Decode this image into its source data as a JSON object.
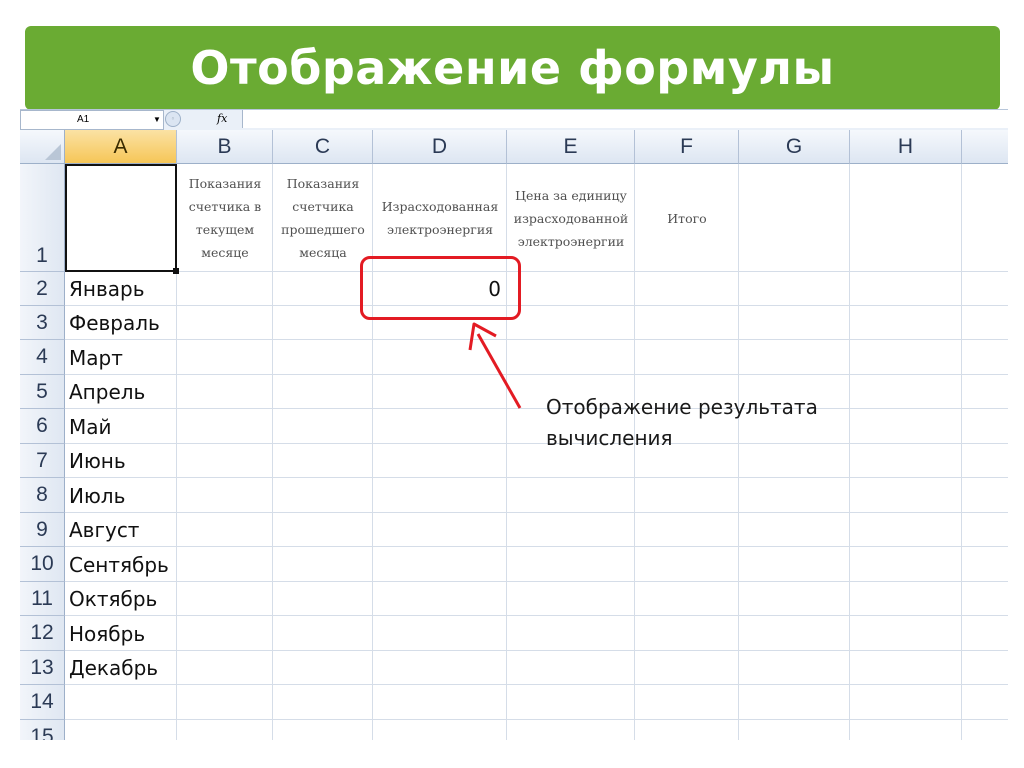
{
  "slide": {
    "title": "Отображение формулы"
  },
  "formula_bar": {
    "name_box": "A1",
    "fx_label": "fx",
    "formula": ""
  },
  "columns": [
    "A",
    "B",
    "C",
    "D",
    "E",
    "F",
    "G",
    "H"
  ],
  "header_row": {
    "row_number": "1",
    "A": "",
    "B": "Показания счетчика в текущем месяце",
    "C": "Показания счетчика прошедшего месяца",
    "D": "Израсходованная электроэнергия",
    "E": "Цена за единицу израсходованной электроэнергии",
    "F": "Итого"
  },
  "rows": [
    {
      "n": "2",
      "month": "Январь",
      "D": "0"
    },
    {
      "n": "3",
      "month": "Февраль"
    },
    {
      "n": "4",
      "month": "Март"
    },
    {
      "n": "5",
      "month": "Апрель"
    },
    {
      "n": "6",
      "month": "Май"
    },
    {
      "n": "7",
      "month": "Июнь"
    },
    {
      "n": "8",
      "month": "Июль"
    },
    {
      "n": "9",
      "month": "Август"
    },
    {
      "n": "10",
      "month": "Сентябрь"
    },
    {
      "n": "11",
      "month": "Октябрь"
    },
    {
      "n": "12",
      "month": "Ноябрь"
    },
    {
      "n": "13",
      "month": "Декабрь"
    },
    {
      "n": "14",
      "month": ""
    },
    {
      "n": "15",
      "month": ""
    }
  ],
  "callout": {
    "text": "Отображение результата вычисления",
    "color": "#e31b23"
  },
  "colors": {
    "banner": "#6aab33",
    "selection_header": "#f6c657"
  }
}
